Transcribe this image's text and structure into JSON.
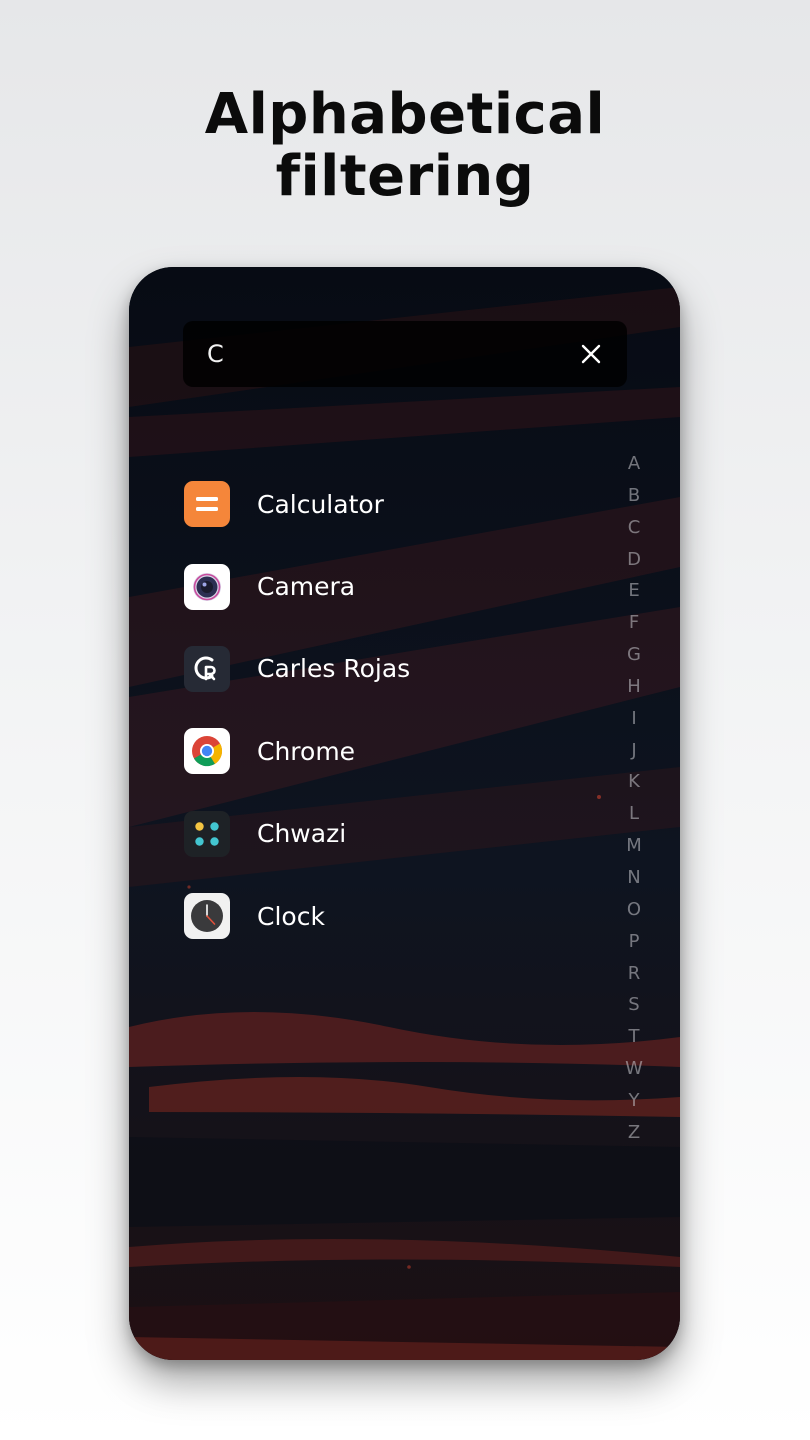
{
  "headline": {
    "line1": "Alphabetical",
    "line2": "filtering"
  },
  "search": {
    "value": "C",
    "clear_icon": "close-icon"
  },
  "apps": [
    {
      "name": "Calculator",
      "icon": "calculator-icon",
      "color": "#f5863a"
    },
    {
      "name": "Camera",
      "icon": "camera-icon",
      "color": "#ffffff"
    },
    {
      "name": "Carles Rojas",
      "icon": "carles-rojas-icon",
      "color": "#262a35"
    },
    {
      "name": "Chrome",
      "icon": "chrome-icon",
      "color": "#ffffff"
    },
    {
      "name": "Chwazi",
      "icon": "chwazi-icon",
      "color": "#1e2226"
    },
    {
      "name": "Clock",
      "icon": "clock-icon",
      "color": "#f1f1f1"
    }
  ],
  "alphabet": [
    "A",
    "B",
    "C",
    "D",
    "E",
    "F",
    "G",
    "H",
    "I",
    "J",
    "K",
    "L",
    "M",
    "N",
    "O",
    "P",
    "R",
    "S",
    "T",
    "W",
    "Y",
    "Z"
  ],
  "colors": {
    "phone_background": "#0a101a",
    "brush_red": "#8c2a24",
    "index_letter": "#c8c8cd"
  }
}
